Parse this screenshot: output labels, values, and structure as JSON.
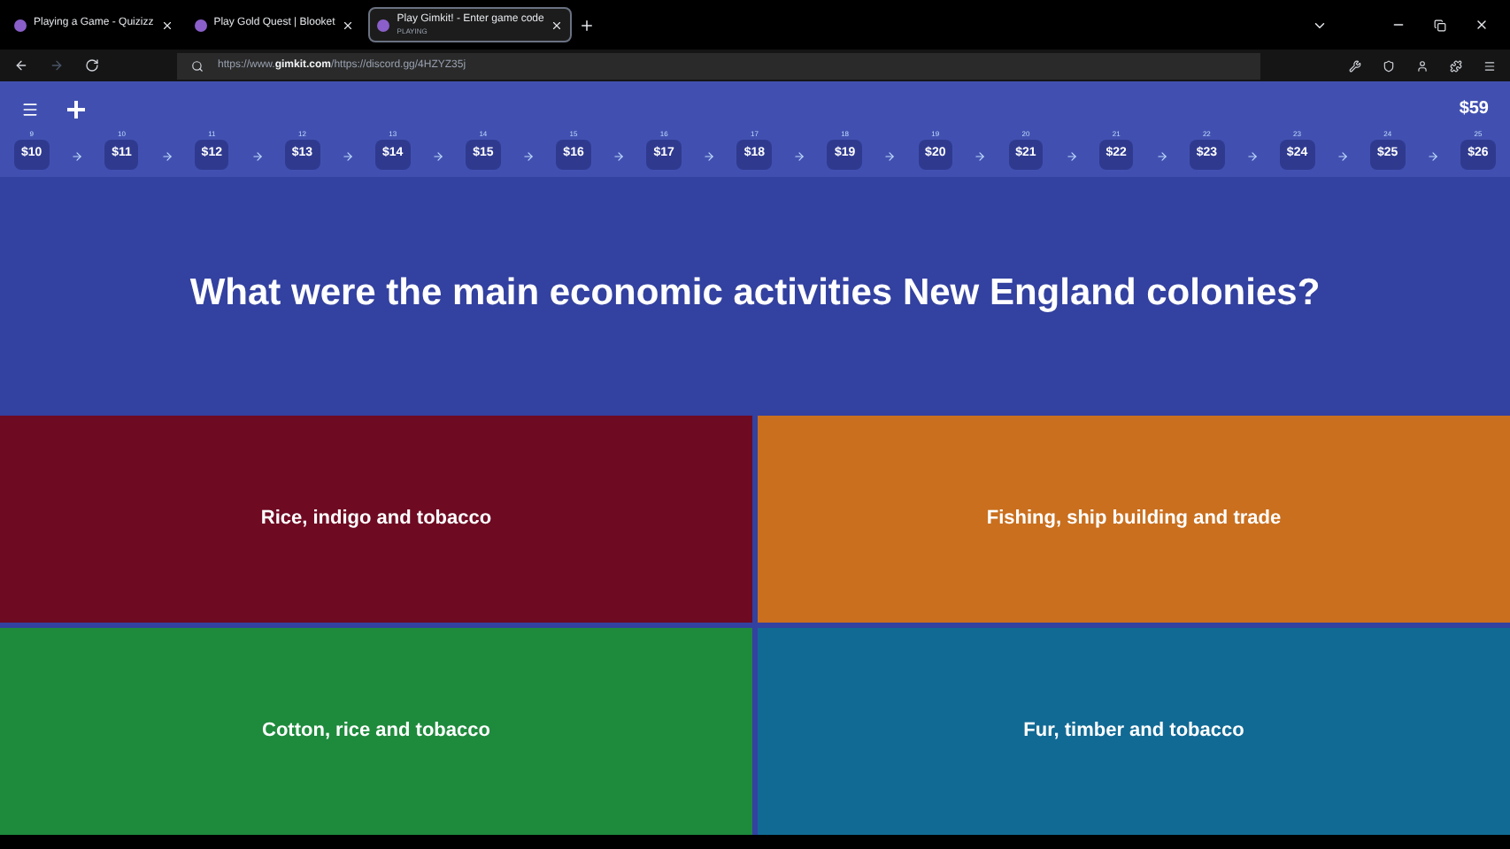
{
  "browser": {
    "tabs": [
      {
        "title": "Playing a Game - Quizizz",
        "selected": false
      },
      {
        "title": "Play Gold Quest | Blooket",
        "selected": false
      },
      {
        "title": "Play Gimkit! - Enter game code",
        "subtitle": "PLAYING",
        "selected": true
      }
    ],
    "address": "https://www.**gimkit.com**/https://discord.gg/4HZYZ35j"
  },
  "game": {
    "balance": "$59",
    "levels": [
      {
        "number": "9",
        "value": "$10"
      },
      {
        "number": "10",
        "value": "$11"
      },
      {
        "number": "11",
        "value": "$12"
      },
      {
        "number": "12",
        "value": "$13"
      },
      {
        "number": "13",
        "value": "$14"
      },
      {
        "number": "14",
        "value": "$15"
      },
      {
        "number": "15",
        "value": "$16"
      },
      {
        "number": "16",
        "value": "$17"
      },
      {
        "number": "17",
        "value": "$18"
      },
      {
        "number": "18",
        "value": "$19"
      },
      {
        "number": "19",
        "value": "$20"
      },
      {
        "number": "20",
        "value": "$21"
      },
      {
        "number": "21",
        "value": "$22"
      },
      {
        "number": "22",
        "value": "$23"
      },
      {
        "number": "23",
        "value": "$24"
      },
      {
        "number": "24",
        "value": "$25"
      },
      {
        "number": "25",
        "value": "$26"
      }
    ],
    "question": "What were the main economic activities New England colonies?",
    "answers": [
      {
        "text": "Rice, indigo and tobacco",
        "color": "#6e0a22"
      },
      {
        "text": "Fishing, ship building and trade",
        "color": "#c96f1e"
      },
      {
        "text": "Cotton, rice and tobacco",
        "color": "#1e8a3c"
      },
      {
        "text": "Fur, timber and tobacco",
        "color": "#116a94"
      }
    ]
  }
}
